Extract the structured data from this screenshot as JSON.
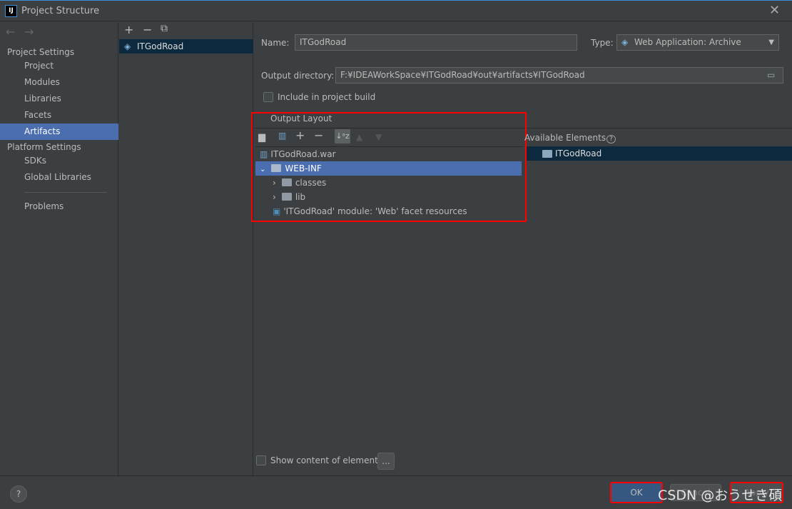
{
  "window": {
    "title": "Project Structure",
    "logo": "IJ"
  },
  "sidebar": {
    "project_settings": "Project Settings",
    "items": [
      {
        "label": "Project"
      },
      {
        "label": "Modules"
      },
      {
        "label": "Libraries"
      },
      {
        "label": "Facets"
      },
      {
        "label": "Artifacts",
        "selected": true
      }
    ],
    "platform_settings": "Platform Settings",
    "platform_items": [
      {
        "label": "SDKs"
      },
      {
        "label": "Global Libraries"
      }
    ],
    "problems": "Problems"
  },
  "artifacts": {
    "items": [
      "ITGodRoad"
    ]
  },
  "form": {
    "name_label": "Name:",
    "name_value": "ITGodRoad",
    "type_label": "Type:",
    "type_value": "Web Application: Archive",
    "output_dir_label": "Output directory:",
    "output_dir_value": "F:¥IDEAWorkSpace¥ITGodRoad¥out¥artifacts¥ITGodRoad",
    "include_label": "Include in project build",
    "output_layout_tab": "Output Layout",
    "available_label": "Available Elements",
    "available_items": [
      "ITGodRoad"
    ],
    "show_content_label": "Show content of elements",
    "more_button": "..."
  },
  "tree": [
    "ITGodRoad.war",
    "WEB-INF",
    "classes",
    "lib",
    "'ITGodRoad' module: 'Web' facet resources"
  ],
  "buttons": {
    "ok": "OK",
    "cancel": "Cancel",
    "apply": "Apply",
    "help": "?"
  },
  "watermark": "CSDN @おうせき碩",
  "colors": {
    "selection": "#4b6eaf",
    "highlight": "#ff0000"
  }
}
